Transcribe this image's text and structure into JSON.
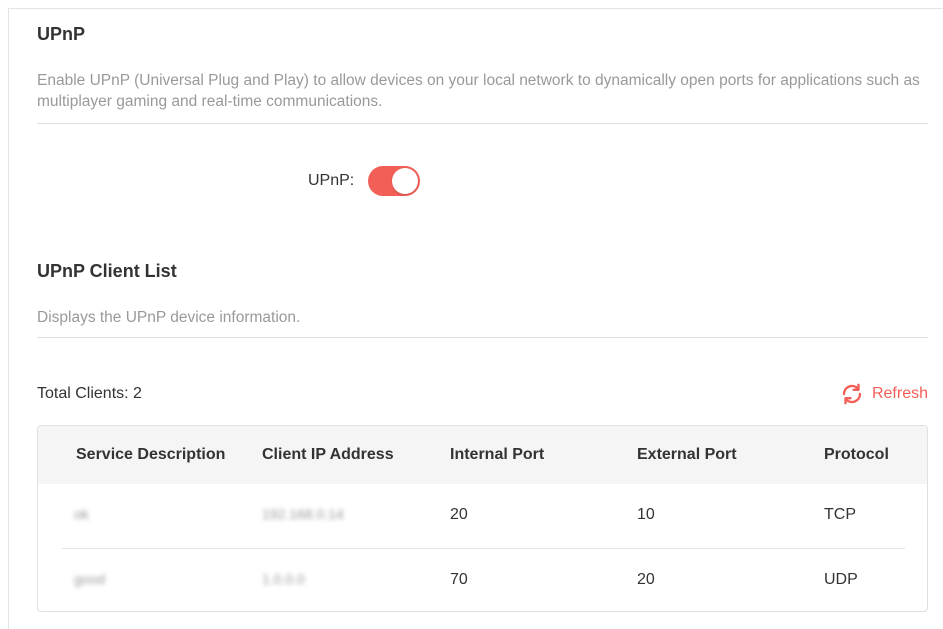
{
  "upnp_section": {
    "title": "UPnP",
    "description": "Enable UPnP (Universal Plug and Play) to allow devices on your local network to dynamically open ports for applications such as multiplayer gaming and real-time communications.",
    "toggle_label": "UPnP:",
    "toggle_state": "on",
    "accent_color": "#f25f57"
  },
  "client_list": {
    "title": "UPnP Client List",
    "description": "Displays the UPnP device information.",
    "total_label": "Total Clients: 2",
    "refresh_label": "Refresh",
    "refresh_icon": "refresh-icon",
    "columns": [
      "Service Description",
      "Client IP Address",
      "Internal Port",
      "External Port",
      "Protocol"
    ],
    "rows": [
      {
        "service": "ok",
        "ip": "192.168.0.14",
        "internal": "20",
        "external": "10",
        "protocol": "TCP"
      },
      {
        "service": "good",
        "ip": "1.0.0.0",
        "internal": "70",
        "external": "20",
        "protocol": "UDP"
      }
    ]
  }
}
